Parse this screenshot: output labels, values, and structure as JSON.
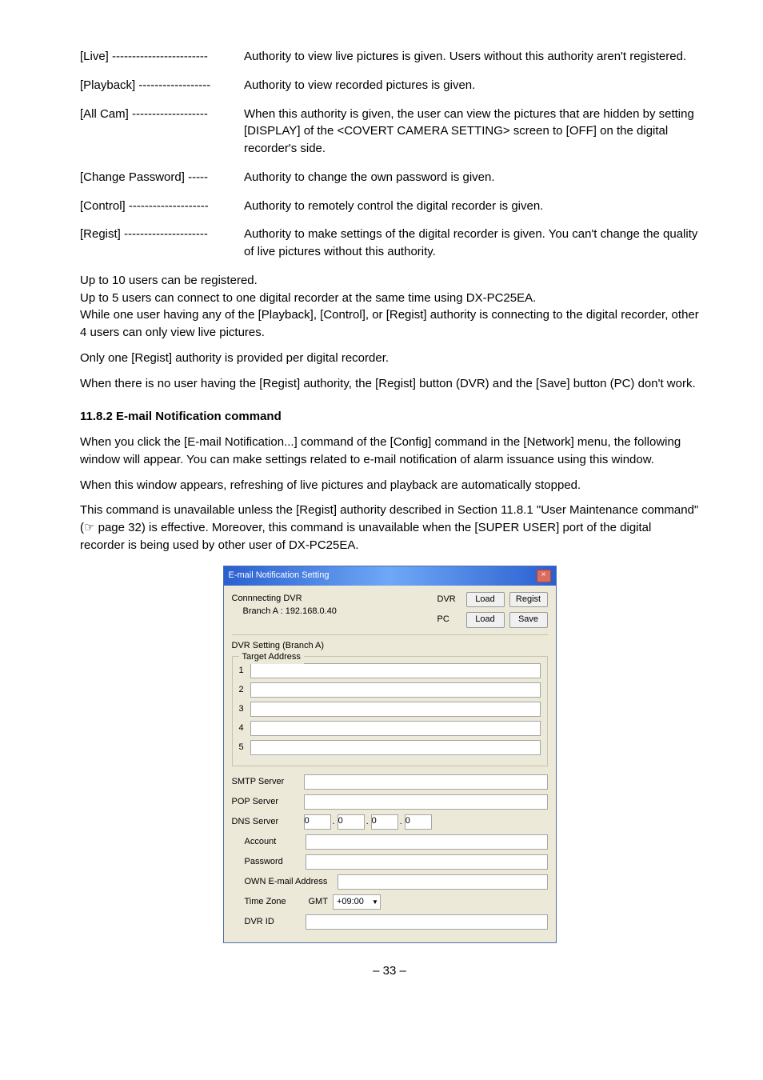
{
  "defs": [
    {
      "label": "[Live] ------------------------ ",
      "desc": "Authority to view live pictures is given.  Users without this authority aren't registered."
    },
    {
      "label": "[Playback] ------------------ ",
      "desc": "Authority to view recorded pictures is given."
    },
    {
      "label": "[All Cam] ------------------- ",
      "desc": "When this authority is given, the user can view the pictures that are hidden by setting [DISPLAY] of the <COVERT CAMERA SETTING> screen to [OFF] on the digital recorder's side."
    },
    {
      "label": "[Change Password] ----- ",
      "desc": "Authority to change the own password is given."
    },
    {
      "label": "[Control] -------------------- ",
      "desc": "Authority to remotely control the digital recorder is given."
    },
    {
      "label": "[Regist] --------------------- ",
      "desc": "Authority to make settings of the digital recorder is given.  You can't change the quality of live pictures without this authority."
    }
  ],
  "p1": "Up to 10 users can be registered.",
  "p2": "Up to 5 users can connect to one digital recorder at the same time using DX-PC25EA.",
  "p3": "While one user having any of the [Playback], [Control], or [Regist] authority is connecting to the digital recorder, other 4 users can only view live pictures.",
  "p4": "Only one [Regist] authority is provided per digital recorder.",
  "p5": "When there is no user having the [Regist] authority, the [Regist] button (DVR) and the [Save] button (PC) don't work.",
  "section_title": "11.8.2 E-mail Notification command",
  "s1": "When you click the [E-mail Notification...] command of the [Config] command in the [Network] menu, the following window will appear. You can make settings related to e-mail notification of alarm issuance using this window.",
  "s2": "When this window appears, refreshing of live pictures and playback are automatically stopped.",
  "s3": "This command is unavailable unless the [Regist] authority described in Section 11.8.1 \"User Maintenance command\" (☞ page 32) is effective.  Moreover, this command is unavailable when the [SUPER USER] port of the digital recorder is being used by other user of DX-PC25EA.",
  "dialog": {
    "title": "E-mail Notification Setting",
    "close": "×",
    "connecting": "Connnecting DVR",
    "branch": "Branch A : 192.168.0.40",
    "dvr_lbl": "DVR",
    "pc_lbl": "PC",
    "load_btn": "Load",
    "regist_btn": "Regist",
    "save_btn": "Save",
    "dvr_setting": "DVR Setting    (Branch A)",
    "target_legend": "Target Address",
    "nums": [
      "1",
      "2",
      "3",
      "4",
      "5"
    ],
    "smtp": "SMTP Server",
    "pop": "POP Server",
    "dns": "DNS Server",
    "dns_val": "0",
    "account": "Account",
    "password": "Password",
    "own": "OWN E-mail Address",
    "timezone": "Time Zone",
    "gmt": "GMT",
    "tz_val": "+09:00",
    "dvrid": "DVR ID"
  },
  "footer": "– 33 –"
}
